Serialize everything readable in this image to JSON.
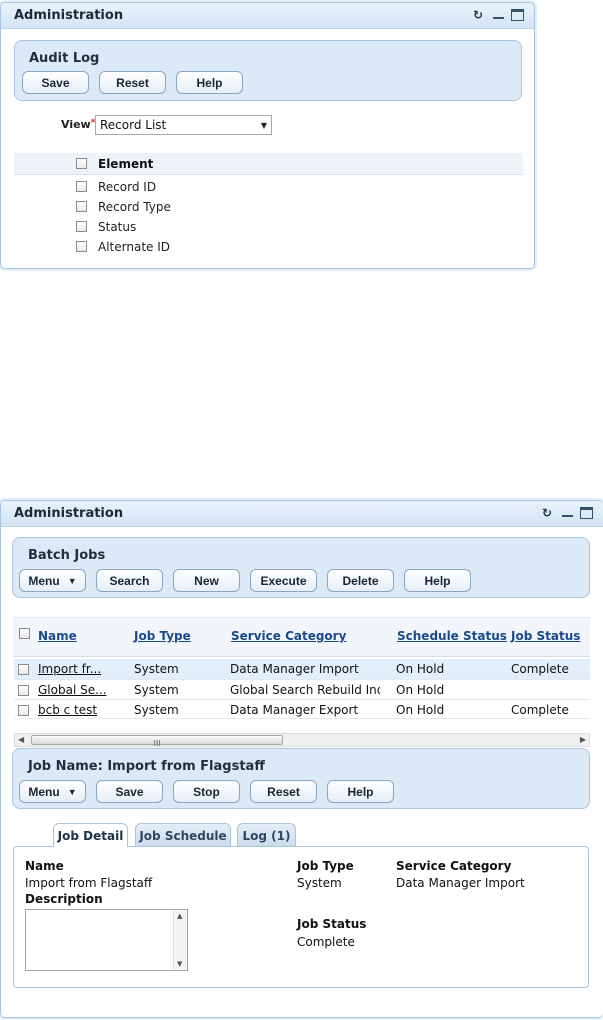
{
  "win1": {
    "title": "Administration",
    "panel_title": "Audit Log",
    "buttons": {
      "save": "Save",
      "reset": "Reset",
      "help": "Help"
    },
    "view_label": "View",
    "required_mark": "*",
    "view_value": "Record List",
    "element_header": "Element",
    "elements": [
      "Record ID",
      "Record Type",
      "Status",
      "Alternate ID"
    ]
  },
  "win2": {
    "title": "Administration",
    "batch_title": "Batch Jobs",
    "buttons": {
      "menu": "Menu",
      "search": "Search",
      "new": "New",
      "execute": "Execute",
      "delete": "Delete",
      "help": "Help"
    },
    "columns": [
      "Name",
      "Job Type",
      "Service Category",
      "Schedule Status",
      "Job Status"
    ],
    "rows": [
      {
        "name": "Import fr...",
        "job_type": "System",
        "category": "Data Manager Import",
        "schedule": "On Hold",
        "status": "Complete"
      },
      {
        "name": "Global Se...",
        "job_type": "System",
        "category": "Global Search Rebuild Index",
        "schedule": "On Hold",
        "status": ""
      },
      {
        "name": "bcb c test",
        "job_type": "System",
        "category": "Data Manager Export",
        "schedule": "On Hold",
        "status": "Complete"
      }
    ],
    "scroll_grip": "III",
    "job_title": "Job Name: Import from Flagstaff",
    "job_buttons": {
      "menu": "Menu",
      "save": "Save",
      "stop": "Stop",
      "reset": "Reset",
      "help": "Help"
    },
    "tabs": [
      "Job Detail",
      "Job Schedule",
      "Log (1)"
    ],
    "detail": {
      "name_label": "Name",
      "name_value": "Import from Flagstaff",
      "description_label": "Description",
      "job_type_label": "Job Type",
      "job_type_value": "System",
      "service_category_label": "Service Category",
      "service_category_value": "Data Manager Import",
      "job_status_label": "Job Status",
      "job_status_value": "Complete"
    }
  }
}
